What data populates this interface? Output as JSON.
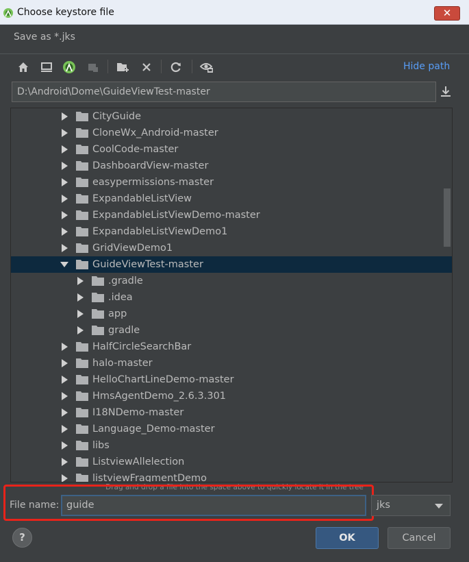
{
  "window": {
    "title": "Choose keystore file",
    "close_glyph": "✕"
  },
  "subtitle": "Save as *.jks",
  "toolbar": {
    "icons": [
      "home-icon",
      "desktop-icon",
      "android-project-icon",
      "module-icon",
      "new-folder-icon",
      "delete-icon",
      "refresh-icon",
      "show-hidden-icon"
    ],
    "hide_path": "Hide path"
  },
  "path": {
    "value": "D:\\Android\\Dome\\GuideViewTest-master"
  },
  "tree": {
    "rows": [
      {
        "label": "CityGuide",
        "depth": 0,
        "expanded": false,
        "selected": false
      },
      {
        "label": "CloneWx_Android-master",
        "depth": 0,
        "expanded": false,
        "selected": false
      },
      {
        "label": "CoolCode-master",
        "depth": 0,
        "expanded": false,
        "selected": false
      },
      {
        "label": "DashboardView-master",
        "depth": 0,
        "expanded": false,
        "selected": false
      },
      {
        "label": "easypermissions-master",
        "depth": 0,
        "expanded": false,
        "selected": false
      },
      {
        "label": "ExpandableListView",
        "depth": 0,
        "expanded": false,
        "selected": false
      },
      {
        "label": "ExpandableListViewDemo-master",
        "depth": 0,
        "expanded": false,
        "selected": false
      },
      {
        "label": "ExpandableListViewDemo1",
        "depth": 0,
        "expanded": false,
        "selected": false
      },
      {
        "label": "GridViewDemo1",
        "depth": 0,
        "expanded": false,
        "selected": false
      },
      {
        "label": "GuideViewTest-master",
        "depth": 0,
        "expanded": true,
        "selected": true
      },
      {
        "label": ".gradle",
        "depth": 1,
        "expanded": false,
        "selected": false
      },
      {
        "label": ".idea",
        "depth": 1,
        "expanded": false,
        "selected": false
      },
      {
        "label": "app",
        "depth": 1,
        "expanded": false,
        "selected": false
      },
      {
        "label": "gradle",
        "depth": 1,
        "expanded": false,
        "selected": false
      },
      {
        "label": "HalfCircleSearchBar",
        "depth": 0,
        "expanded": false,
        "selected": false
      },
      {
        "label": "halo-master",
        "depth": 0,
        "expanded": false,
        "selected": false
      },
      {
        "label": "HelloChartLineDemo-master",
        "depth": 0,
        "expanded": false,
        "selected": false
      },
      {
        "label": "HmsAgentDemo_2.6.3.301",
        "depth": 0,
        "expanded": false,
        "selected": false
      },
      {
        "label": "I18NDemo-master",
        "depth": 0,
        "expanded": false,
        "selected": false
      },
      {
        "label": "Language_Demo-master",
        "depth": 0,
        "expanded": false,
        "selected": false
      },
      {
        "label": "libs",
        "depth": 0,
        "expanded": false,
        "selected": false
      },
      {
        "label": "ListviewAllelection",
        "depth": 0,
        "expanded": false,
        "selected": false
      },
      {
        "label": "listviewFragmentDemo",
        "depth": 0,
        "expanded": false,
        "selected": false
      }
    ]
  },
  "hint": "Drag and drop a file into the space above to quickly locate it in the tree",
  "file_name": {
    "label": "File name:",
    "value": "guide"
  },
  "extension": {
    "selected": "jks"
  },
  "buttons": {
    "help": "?",
    "ok": "OK",
    "cancel": "Cancel"
  },
  "colors": {
    "background": "#3c3f41",
    "selection": "#0d293e",
    "link": "#589df6",
    "ok_button": "#365880",
    "highlight_box": "#e8231a"
  }
}
